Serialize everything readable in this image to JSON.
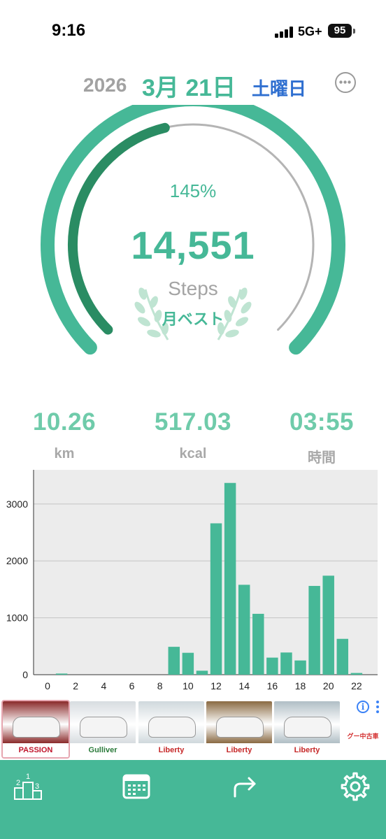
{
  "status_bar": {
    "time": "9:16",
    "network": "5G+",
    "battery": "95"
  },
  "date": {
    "year": "2026",
    "month_day": "3月 21日",
    "weekday": "土曜日"
  },
  "progress": {
    "percent_label": "145%",
    "fraction": 1.45
  },
  "steps": {
    "value": "14,551",
    "label": "Steps",
    "badge": "月ベスト"
  },
  "stats": [
    {
      "value": "10.26",
      "unit": "km"
    },
    {
      "value": "517.03",
      "unit": "kcal"
    },
    {
      "value": "03:55",
      "unit": "時間"
    }
  ],
  "chart_data": {
    "type": "bar",
    "x": [
      0,
      1,
      2,
      3,
      4,
      5,
      6,
      7,
      8,
      9,
      10,
      11,
      12,
      13,
      14,
      15,
      16,
      17,
      18,
      19,
      20,
      21,
      22,
      23
    ],
    "x_ticks": [
      0,
      2,
      4,
      6,
      8,
      10,
      12,
      14,
      16,
      18,
      20,
      22
    ],
    "values": [
      0,
      20,
      0,
      0,
      0,
      0,
      0,
      0,
      0,
      490,
      385,
      70,
      2660,
      3370,
      1580,
      1070,
      300,
      390,
      250,
      1560,
      1740,
      630,
      30,
      0
    ],
    "ylim": [
      0,
      3600
    ],
    "y_ticks": [
      0,
      1000,
      2000,
      3000
    ],
    "grid": true,
    "bar_color": "#46b897",
    "plot_background": "#ececec"
  },
  "ads": [
    {
      "logo": "PASSION",
      "logo_color": "#c0152b",
      "bg": "#8a2a2a"
    },
    {
      "logo": "Gulliver",
      "logo_color": "#2a7a3a",
      "bg": "#d7dce0"
    },
    {
      "logo": "Liberty",
      "logo_color": "#c62828",
      "bg": "#cfd8dc"
    },
    {
      "logo": "Liberty",
      "logo_color": "#c62828",
      "bg": "#8a6a42"
    },
    {
      "logo": "Liberty",
      "logo_color": "#c62828",
      "bg": "#b0bec5"
    }
  ],
  "ad_tail": {
    "logo": "グー中古車",
    "logo_color": "#d32f2f"
  },
  "tabs": [
    {
      "icon": "ranking-podium-icon"
    },
    {
      "icon": "calendar-icon"
    },
    {
      "icon": "share-arrow-icon"
    },
    {
      "icon": "gear-icon"
    }
  ],
  "colors": {
    "accent": "#46b897",
    "accent_dark": "#2a8c63",
    "weekday": "#2f6fd0",
    "muted": "#a4a4a4"
  }
}
